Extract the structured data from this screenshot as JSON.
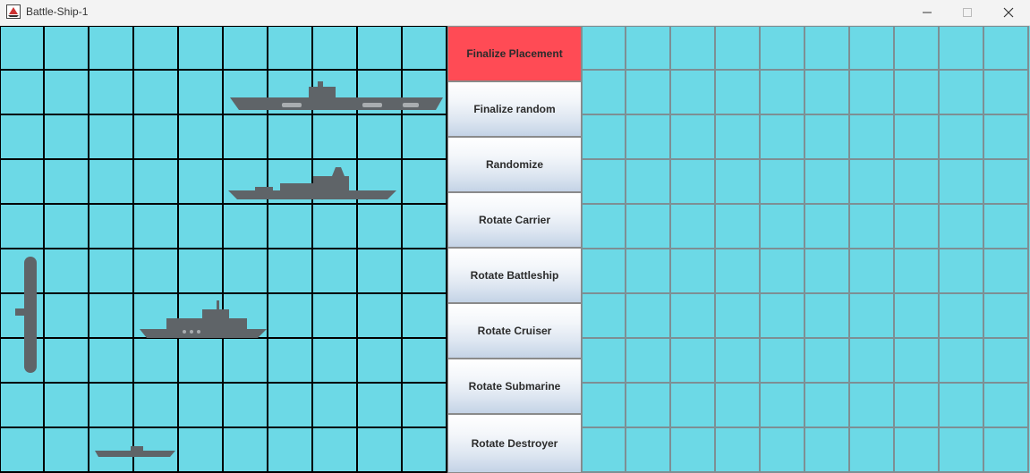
{
  "window": {
    "title": "Battle-Ship-1"
  },
  "colors": {
    "water": "#6cd9e6",
    "player_grid": "#000000",
    "enemy_grid": "#7d8f94",
    "active_button": "#ff4b55",
    "ship": "#5f6468"
  },
  "player_board": {
    "rows": 10,
    "cols": 10
  },
  "enemy_board": {
    "rows": 10,
    "cols": 10
  },
  "buttons": [
    {
      "label": "Finalize Placement",
      "active": true
    },
    {
      "label": "Finalize random",
      "active": false
    },
    {
      "label": "Randomize",
      "active": false
    },
    {
      "label": "Rotate Carrier",
      "active": false
    },
    {
      "label": "Rotate Battleship",
      "active": false
    },
    {
      "label": "Rotate Cruiser",
      "active": false
    },
    {
      "label": "Rotate Submarine",
      "active": false
    },
    {
      "label": "Rotate Destroyer",
      "active": false
    }
  ],
  "ships": [
    {
      "name": "carrier-icon",
      "orientation": "horizontal"
    },
    {
      "name": "battleship-icon",
      "orientation": "horizontal"
    },
    {
      "name": "cruiser-icon",
      "orientation": "horizontal"
    },
    {
      "name": "submarine-icon",
      "orientation": "vertical"
    },
    {
      "name": "destroyer-icon",
      "orientation": "horizontal"
    }
  ]
}
